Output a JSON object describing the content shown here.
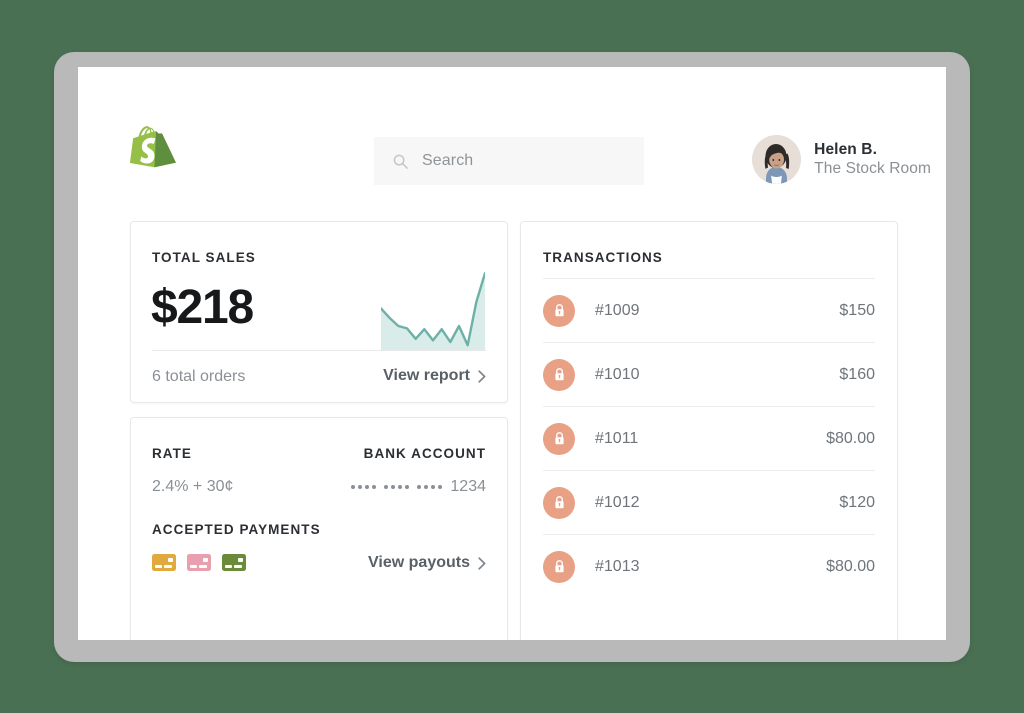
{
  "colors": {
    "background": "#4a7053",
    "bezel": "#b9b9b9",
    "screen": "#ffffff",
    "accent_green": "#95bf47",
    "sparkline": "#6cb0a8",
    "lock_circle": "#e8a184",
    "card_gold": "#e0aa3e",
    "card_pink": "#e8a0ae",
    "card_green": "#6b8a3a",
    "text_dark": "#2b2f33",
    "text_muted": "#8b9096",
    "text_link": "#596066",
    "border": "#e8e8e8"
  },
  "topbar": {
    "logo_name": "shopify-logo",
    "search": {
      "icon": "search-icon",
      "placeholder": "Search",
      "value": ""
    },
    "user": {
      "avatar_alt": "user-avatar",
      "name": "Helen B.",
      "store": "The Stock Room"
    }
  },
  "total_sales": {
    "title": "TOTAL SALES",
    "amount": "$218",
    "orders": "6 total orders",
    "link_label": "View report",
    "chevron": "chevron-right-icon"
  },
  "chart_data": {
    "type": "line",
    "title": "Total sales sparkline",
    "xlabel": "",
    "ylabel": "",
    "grid": false,
    "legend": false,
    "x": [
      0,
      1,
      2,
      3,
      4,
      5,
      6,
      7,
      8,
      9,
      10,
      11,
      12
    ],
    "values": [
      52,
      40,
      30,
      27,
      14,
      26,
      12,
      26,
      10,
      30,
      6,
      60,
      96
    ],
    "ylim": [
      0,
      100
    ],
    "series": [
      {
        "name": "sales",
        "values": [
          52,
          40,
          30,
          27,
          14,
          26,
          12,
          26,
          10,
          30,
          6,
          60,
          96
        ],
        "color": "#6cb0a8",
        "fill": "#d9ecea"
      }
    ]
  },
  "rate_card": {
    "rate_title": "RATE",
    "rate_value": "2.4% + 30¢",
    "bank_title": "BANK ACCOUNT",
    "bank_masked_groups": 3,
    "bank_dots_per_group": 4,
    "bank_last4": "1234",
    "accepted_title": "ACCEPTED PAYMENTS",
    "accepted_cards": [
      {
        "name": "credit-card-gold",
        "color": "#e0aa3e"
      },
      {
        "name": "credit-card-pink",
        "color": "#e8a0ae"
      },
      {
        "name": "credit-card-green",
        "color": "#6b8a3a"
      }
    ],
    "link_label": "View payouts",
    "chevron": "chevron-right-icon"
  },
  "transactions": {
    "title": "TRANSACTIONS",
    "rows": [
      {
        "icon": "lock-icon",
        "id": "#1009",
        "amount": "$150"
      },
      {
        "icon": "lock-icon",
        "id": "#1010",
        "amount": "$160"
      },
      {
        "icon": "lock-icon",
        "id": "#1011",
        "amount": "$80.00"
      },
      {
        "icon": "lock-icon",
        "id": "#1012",
        "amount": "$120"
      },
      {
        "icon": "lock-icon",
        "id": "#1013",
        "amount": "$80.00"
      }
    ]
  }
}
